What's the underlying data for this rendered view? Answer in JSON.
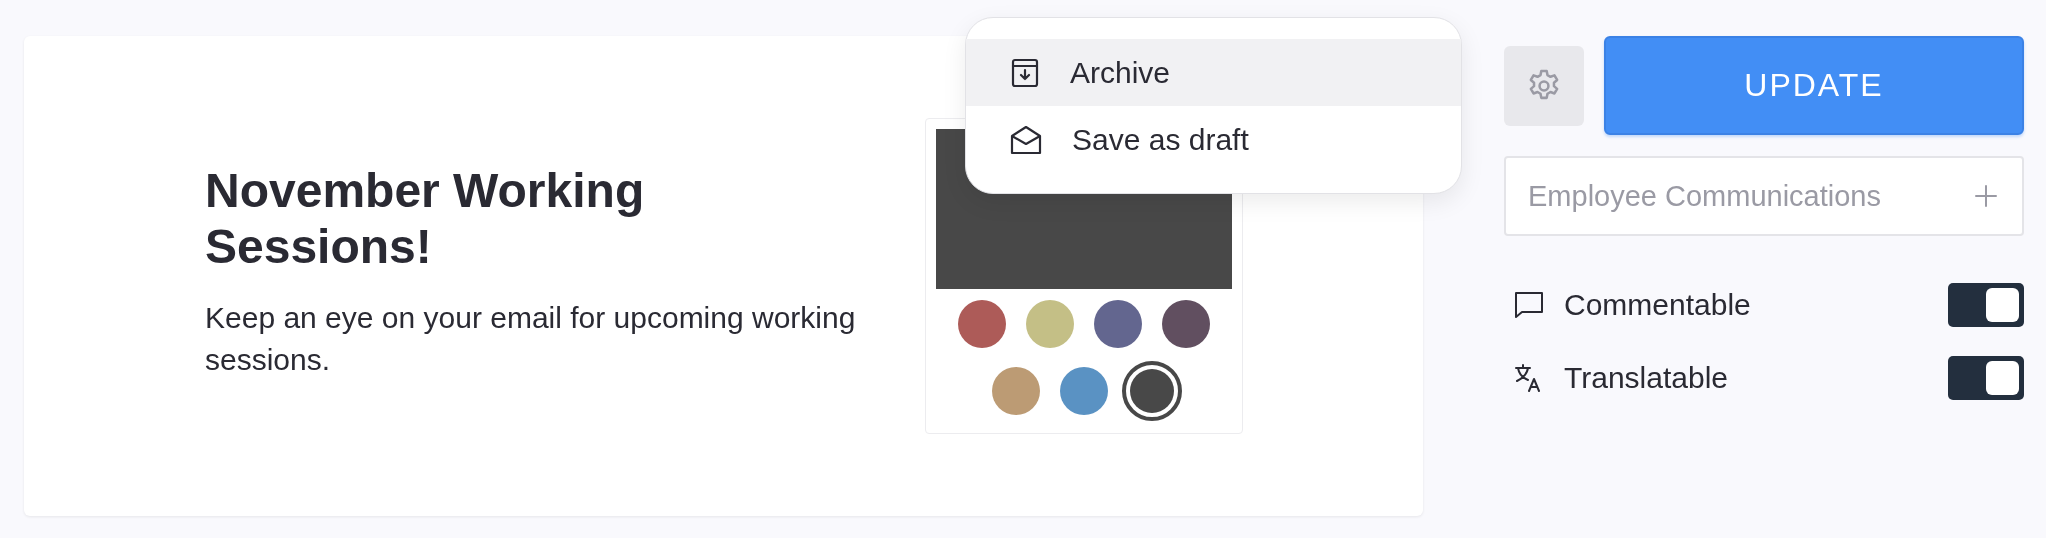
{
  "card": {
    "title": "November Working Sessions!",
    "body": "Keep an eye on your email for upcoming working sessions.",
    "color_picker": {
      "swatches": [
        {
          "color": "#ad5b58",
          "selected": false
        },
        {
          "color": "#c4bf86",
          "selected": false
        },
        {
          "color": "#63668f",
          "selected": false
        },
        {
          "color": "#614f60",
          "selected": false
        },
        {
          "color": "#bc9b74",
          "selected": false
        },
        {
          "color": "#5a92c3",
          "selected": false
        },
        {
          "color": "#484848",
          "selected": true
        }
      ]
    }
  },
  "menu": {
    "items": [
      {
        "label": "Archive",
        "kind": "archive",
        "selected": true
      },
      {
        "label": "Save as draft",
        "kind": "draft",
        "selected": false
      }
    ]
  },
  "update_button": "UPDATE",
  "category_field": {
    "placeholder": "Employee Communications"
  },
  "options": [
    {
      "label": "Commentable",
      "kind": "comment",
      "on": true
    },
    {
      "label": "Translatable",
      "kind": "translate",
      "on": true
    }
  ]
}
